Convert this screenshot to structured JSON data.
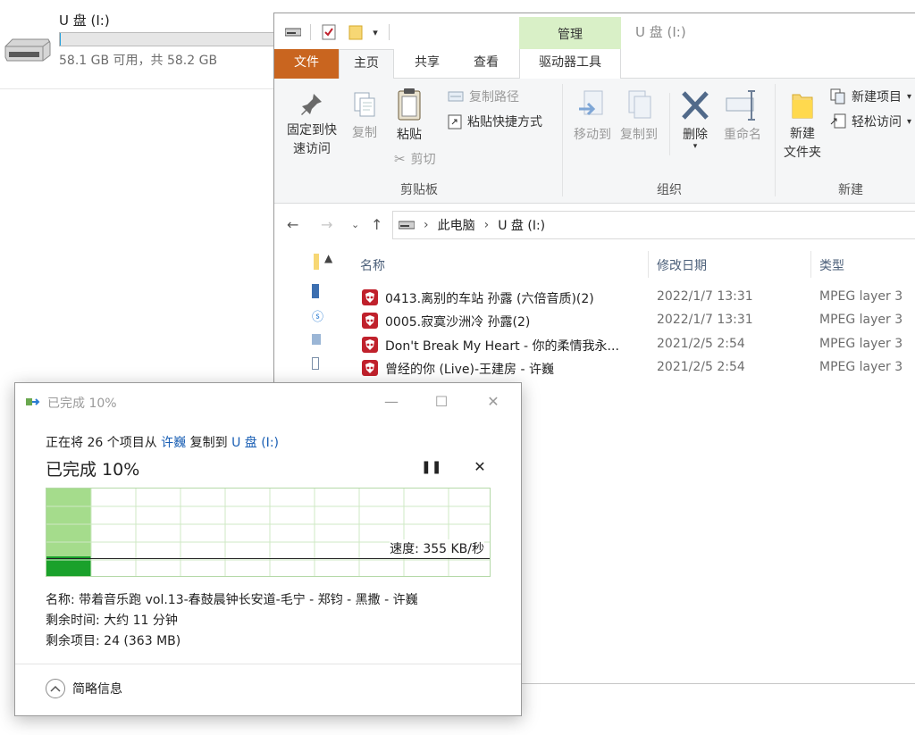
{
  "drive_tile": {
    "name": "U 盘 (I:)",
    "space": "58.1 GB 可用，共 58.2 GB",
    "used_fraction": 0.002
  },
  "explorer": {
    "title": "U 盘 (I:)",
    "context_tab": "管理",
    "tabs": {
      "file": "文件",
      "home": "主页",
      "share": "共享",
      "view": "查看",
      "drive_tools": "驱动器工具"
    },
    "ribbon": {
      "pin": "固定到快\n速访问",
      "copy": "复制",
      "paste": "粘贴",
      "copy_path": "复制路径",
      "paste_shortcut": "粘贴快捷方式",
      "cut": "剪切",
      "clipboard_group": "剪贴板",
      "move_to": "移动到",
      "copy_to": "复制到",
      "delete": "删除",
      "rename": "重命名",
      "organize_group": "组织",
      "new_folder": "新建\n文件夹",
      "new_item": "新建项目",
      "easy_access": "轻松访问",
      "new_group": "新建"
    },
    "breadcrumb": [
      "此电脑",
      "U 盘 (I:)"
    ],
    "columns": {
      "name": "名称",
      "date": "修改日期",
      "type": "类型"
    },
    "files": [
      {
        "name": "0413.离别的车站 孙露 (六倍音质)(2)",
        "date": "2022/1/7 13:31",
        "type": "MPEG layer 3"
      },
      {
        "name": "0005.寂寞沙洲冷 孙露(2)",
        "date": "2022/1/7 13:31",
        "type": "MPEG layer 3"
      },
      {
        "name": "Don't Break My Heart - 你的柔情我永...",
        "date": "2021/2/5 2:54",
        "type": "MPEG layer 3"
      },
      {
        "name": "曾经的你 (Live)-王建房 - 许巍",
        "date": "2021/2/5 2:54",
        "type": "MPEG layer 3"
      }
    ]
  },
  "copy_dialog": {
    "title": "已完成 10%",
    "line_prefix": "正在将 26 个项目从",
    "source": "许巍",
    "line_mid": "复制到",
    "destination": "U 盘 (I:)",
    "progress_text": "已完成 10%",
    "progress_fraction": 0.1,
    "speed": "速度: 355 KB/秒",
    "name_line": "名称: 带着音乐跑 vol.13-春鼓晨钟长安道-毛宁 - 郑钧 - 黑撒 - 许巍",
    "time_line": "剩余时间: 大约 11 分钟",
    "items_line": "剩余项目: 24 (363 MB)",
    "less_details": "简略信息"
  }
}
